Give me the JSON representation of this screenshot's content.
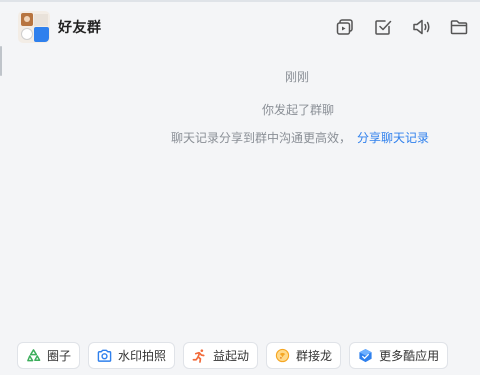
{
  "header": {
    "title": "好友群",
    "icons": [
      "screen-share-icon",
      "task-check-icon",
      "speaker-icon",
      "folder-icon"
    ]
  },
  "messages": {
    "time": "刚刚",
    "created": "你发起了群聊",
    "share_text": "聊天记录分享到群中沟通更高效，",
    "share_link": "分享聊天记录"
  },
  "apps": [
    {
      "label": "圈子",
      "icon": "recycle-circle-icon",
      "color": "#3dae5c"
    },
    {
      "label": "水印拍照",
      "icon": "camera-icon",
      "color": "#2f80ed"
    },
    {
      "label": "益起动",
      "icon": "running-person-icon",
      "color": "#f26b3a"
    },
    {
      "label": "群接龙",
      "icon": "dragon-emoji-icon",
      "color": "#f5a623"
    },
    {
      "label": "更多酷应用",
      "icon": "app-cube-icon",
      "color": "#2f80ed"
    }
  ]
}
